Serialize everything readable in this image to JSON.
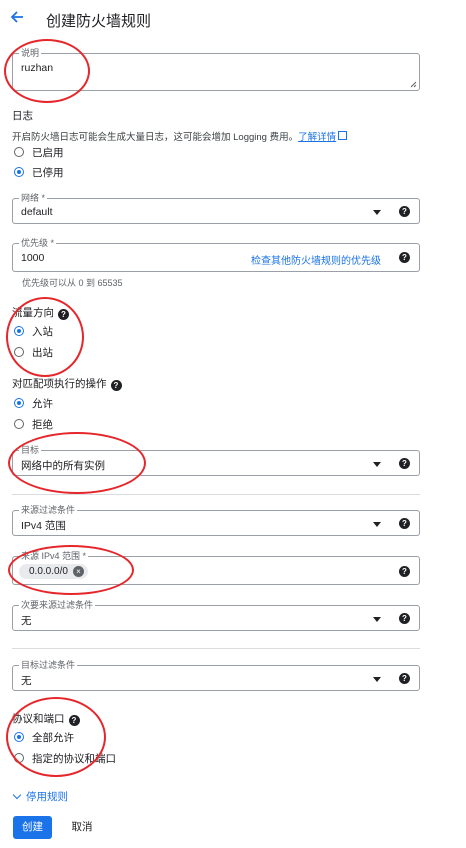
{
  "header": {
    "title": "创建防火墙规则"
  },
  "description": {
    "label": "说明",
    "value": "ruzhan"
  },
  "logs": {
    "title": "日志",
    "text": "开启防火墙日志可能会生成大量日志，这可能会增加 Logging 费用。",
    "link": "了解详情",
    "options": [
      {
        "label": "已启用",
        "selected": false
      },
      {
        "label": "已停用",
        "selected": true
      }
    ]
  },
  "network": {
    "label": "网络 *",
    "value": "default"
  },
  "priority": {
    "label": "优先级 *",
    "value": "1000",
    "link": "检查其他防火墙规则的优先级",
    "hint": "优先级可以从 0 到 65535"
  },
  "direction": {
    "title": "流量方向",
    "options": [
      {
        "label": "入站",
        "selected": true
      },
      {
        "label": "出站",
        "selected": false
      }
    ]
  },
  "action": {
    "title": "对匹配项执行的操作",
    "options": [
      {
        "label": "允许",
        "selected": true
      },
      {
        "label": "拒绝",
        "selected": false
      }
    ]
  },
  "target": {
    "label": "目标",
    "value": "网络中的所有实例"
  },
  "source_filter": {
    "label": "来源过滤条件",
    "value": "IPv4 范围"
  },
  "source_ranges": {
    "label": "来源 IPv4 范围 *",
    "chip": "0.0.0.0/0"
  },
  "secondary_filter": {
    "label": "次要来源过滤条件",
    "value": "无"
  },
  "dest_filter": {
    "label": "目标过滤条件",
    "value": "无"
  },
  "protocols": {
    "title": "协议和端口",
    "options": [
      {
        "label": "全部允许",
        "selected": true
      },
      {
        "label": "指定的协议和端口",
        "selected": false
      }
    ]
  },
  "disable_toggle": "停用规则",
  "buttons": {
    "create": "创建",
    "cancel": "取消"
  },
  "colors": {
    "accent": "#1a73e8",
    "annotation": "#e5262b"
  }
}
